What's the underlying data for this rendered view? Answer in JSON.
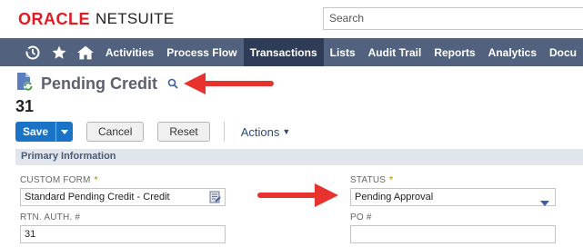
{
  "brand": {
    "oracle": "ORACLE",
    "netsuite": "NETSUITE"
  },
  "search": {
    "placeholder": "Search"
  },
  "nav": {
    "icons": [
      "recent-icon",
      "star-icon",
      "home-icon"
    ],
    "items": [
      {
        "label": "Activities"
      },
      {
        "label": "Process Flow"
      },
      {
        "label": "Transactions",
        "active": true
      },
      {
        "label": "Lists"
      },
      {
        "label": "Audit Trail"
      },
      {
        "label": "Reports"
      },
      {
        "label": "Analytics"
      },
      {
        "label": "Docu"
      }
    ]
  },
  "page": {
    "title": "Pending Credit",
    "record_id": "31",
    "doc_icon": "document-refresh-icon",
    "search_icon": "search-icon"
  },
  "buttons": {
    "save": "Save",
    "cancel": "Cancel",
    "reset": "Reset",
    "actions": "Actions"
  },
  "section": {
    "title": "Primary Information"
  },
  "fields": {
    "custom_form": {
      "label": "CUSTOM FORM",
      "value": "Standard Pending Credit - Credit"
    },
    "status": {
      "label": "STATUS",
      "value": "Pending Approval"
    },
    "rtn_auth": {
      "label": "RTN. AUTH. #",
      "value": "31"
    },
    "po": {
      "label": "PO #",
      "value": ""
    }
  },
  "colors": {
    "brand_red": "#e01b22",
    "nav_bg": "#52627e",
    "nav_active": "#2e3c57",
    "primary_button": "#1a73c7",
    "annotation_arrow": "#e8322e"
  }
}
